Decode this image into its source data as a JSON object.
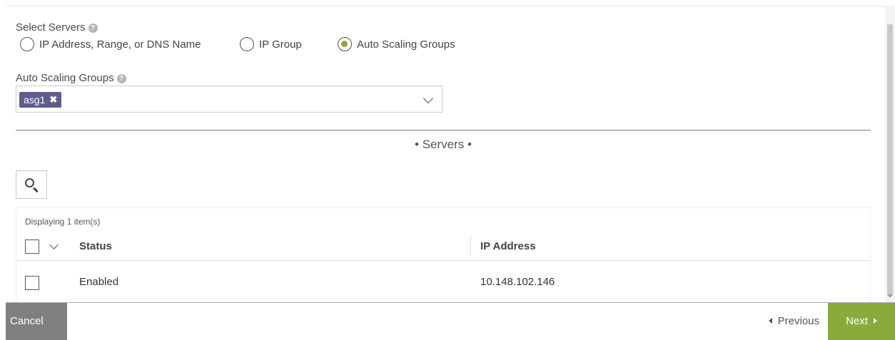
{
  "select_servers": {
    "label": "Select Servers",
    "help_icon": "?",
    "options": [
      {
        "label": "IP Address, Range, or DNS Name",
        "selected": false
      },
      {
        "label": "IP Group",
        "selected": false
      },
      {
        "label": "Auto Scaling Groups",
        "selected": true
      }
    ]
  },
  "asg_field": {
    "label": "Auto Scaling Groups",
    "help_icon": "?",
    "tags": [
      {
        "label": "asg1",
        "remove_icon": "✖"
      }
    ]
  },
  "section": {
    "title": "• Servers •"
  },
  "grid": {
    "count_text": "Displaying 1 item(s)",
    "columns": [
      "Status",
      "IP Address"
    ],
    "rows": [
      {
        "status": "Enabled",
        "ip": "10.148.102.146"
      }
    ]
  },
  "footer": {
    "cancel_label": "Cancel",
    "previous_label": "Previous",
    "next_label": "Next"
  },
  "colors": {
    "accent": "#8aab3c",
    "tag": "#5e5c8f",
    "cancel": "#808080"
  }
}
